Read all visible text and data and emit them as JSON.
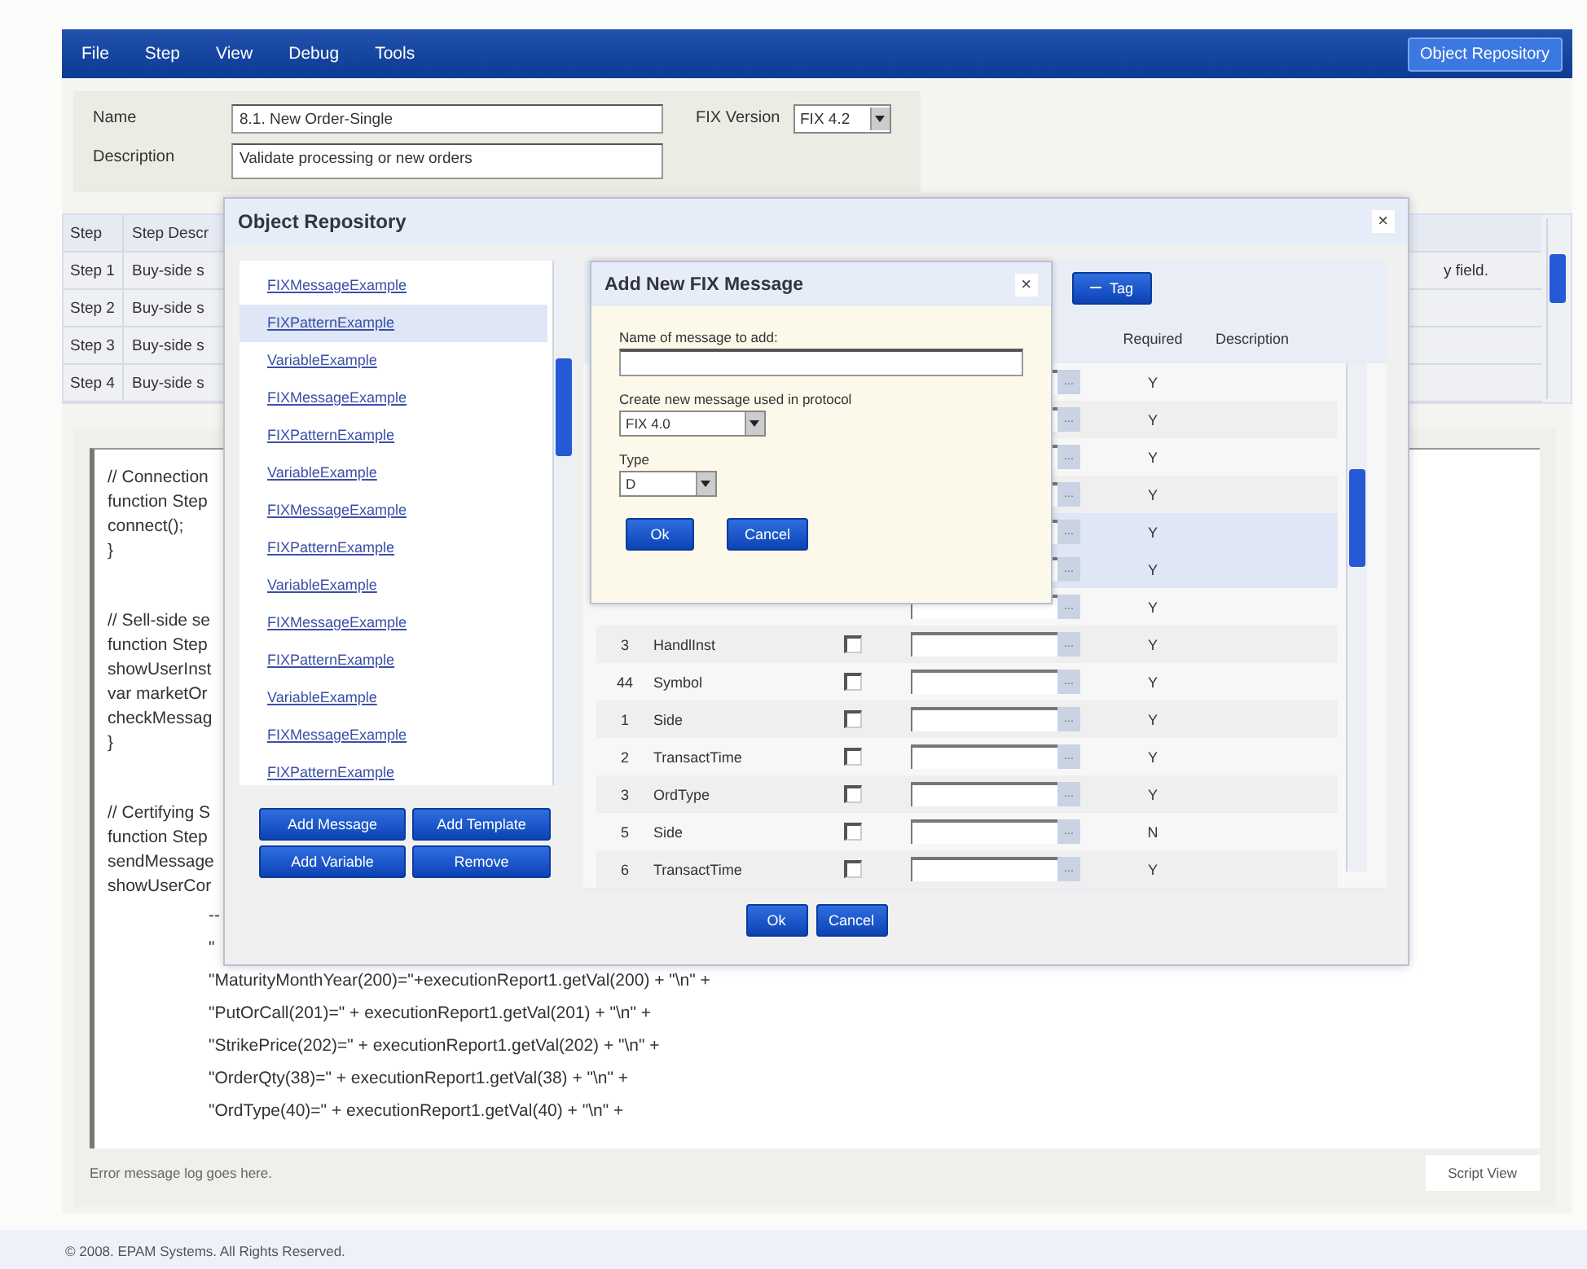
{
  "menu": {
    "items": [
      "File",
      "Step",
      "View",
      "Debug",
      "Tools"
    ],
    "repository_button": "Object Repository"
  },
  "form": {
    "name_label": "Name",
    "name_value": "8.1. New Order-Single",
    "description_label": "Description",
    "description_value": "Validate processing or new orders",
    "fix_version_label": "FIX Version",
    "fix_version_value": "FIX 4.2"
  },
  "steps_table": {
    "columns": [
      "Step",
      "Step Descr"
    ],
    "rows": [
      {
        "step": "Step 1",
        "description": "Buy-side s",
        "column_3": "y field."
      },
      {
        "step": "Step 2",
        "description": "Buy-side s"
      },
      {
        "step": "Step 3",
        "description": "Buy-side s"
      },
      {
        "step": "Step 4",
        "description": "Buy-side s"
      }
    ]
  },
  "script": {
    "blocks": [
      [
        {
          "kind": "statement",
          "text": "// Connection"
        },
        {
          "kind": "statement",
          "text": "function Step"
        },
        {
          "kind": "statement",
          "text": "connect();"
        },
        {
          "kind": "statement",
          "text": "}"
        }
      ],
      [
        {
          "kind": "statement",
          "text": "// Sell-side se"
        },
        {
          "kind": "statement",
          "text": "function Step"
        },
        {
          "kind": "statement",
          "text": "showUserInst"
        },
        {
          "kind": "statement",
          "text": "var marketOr"
        },
        {
          "kind": "statement",
          "text": "checkMessag"
        },
        {
          "kind": "statement",
          "text": "}"
        }
      ],
      [
        {
          "kind": "statement",
          "text": "// Certifying S"
        },
        {
          "kind": "statement",
          "text": "function Step"
        },
        {
          "kind": "statement",
          "text": "sendMessage"
        },
        {
          "kind": "statement",
          "text": "showUserCor"
        },
        {
          "kind": "continuation",
          "text": "--"
        },
        {
          "kind": "continuation",
          "text": "\""
        },
        {
          "kind": "continuation",
          "text": "\"MaturityMonthYear(200)=\"+executionReport1.getVal(200) + \"\\n\" +"
        },
        {
          "kind": "continuation",
          "text": "\"PutOrCall(201)=\" + executionReport1.getVal(201) + \"\\n\" +"
        },
        {
          "kind": "continuation",
          "text": "\"StrikePrice(202)=\" + executionReport1.getVal(202) + \"\\n\" +"
        },
        {
          "kind": "continuation",
          "text": "\"OrderQty(38)=\" + executionReport1.getVal(38) + \"\\n\" +"
        },
        {
          "kind": "continuation",
          "text": "\"OrdType(40)=\" + executionReport1.getVal(40) + \"\\n\" +"
        }
      ]
    ],
    "error_log": "Error message log goes here.",
    "script_view_button": "Script View"
  },
  "footer": "© 2008. EPAM Systems. All Rights Reserved.",
  "object_repository": {
    "title": "Object Repository",
    "close": "×",
    "items": [
      {
        "label": "FIXMessageExample",
        "selected": false
      },
      {
        "label": "FIXPatternExample",
        "selected": true
      },
      {
        "label": "VariableExample",
        "selected": false
      },
      {
        "label": "FIXMessageExample",
        "selected": false
      },
      {
        "label": "FIXPatternExample",
        "selected": false
      },
      {
        "label": "VariableExample",
        "selected": false
      },
      {
        "label": "FIXMessageExample",
        "selected": false
      },
      {
        "label": "FIXPatternExample",
        "selected": false
      },
      {
        "label": "VariableExample",
        "selected": false
      },
      {
        "label": "FIXMessageExample",
        "selected": false
      },
      {
        "label": "FIXPatternExample",
        "selected": false
      },
      {
        "label": "VariableExample",
        "selected": false
      },
      {
        "label": "FIXMessageExample",
        "selected": false
      },
      {
        "label": "FIXPatternExample",
        "selected": false
      }
    ],
    "list_buttons": [
      "Add Message",
      "Add Template",
      "Add Variable",
      "Remove"
    ],
    "tag_button": "Tag",
    "columns": {
      "required": "Required",
      "description": "Description"
    },
    "rows": [
      {
        "browse": "...",
        "required": "Y",
        "selected": false
      },
      {
        "browse": "...",
        "required": "Y",
        "selected": false
      },
      {
        "browse": "...",
        "required": "Y",
        "selected": false
      },
      {
        "browse": "...",
        "required": "Y",
        "selected": false
      },
      {
        "browse": "...",
        "required": "Y",
        "selected": true
      },
      {
        "browse": "...",
        "required": "Y",
        "selected": true
      },
      {
        "browse": "...",
        "required": "Y",
        "selected": false
      },
      {
        "tag": "3",
        "name": "HandlInst",
        "checked": false,
        "browse": "...",
        "required": "Y",
        "selected": false
      },
      {
        "tag": "44",
        "name": "Symbol",
        "checked": false,
        "browse": "...",
        "required": "Y",
        "selected": false
      },
      {
        "tag": "1",
        "name": "Side",
        "checked": false,
        "browse": "...",
        "required": "Y",
        "selected": false
      },
      {
        "tag": "2",
        "name": "TransactTime",
        "checked": false,
        "browse": "...",
        "required": "Y",
        "selected": false
      },
      {
        "tag": "3",
        "name": "OrdType",
        "checked": false,
        "browse": "...",
        "required": "Y",
        "selected": false
      },
      {
        "tag": "5",
        "name": "Side",
        "checked": false,
        "browse": "...",
        "required": "N",
        "selected": false
      },
      {
        "tag": "6",
        "name": "TransactTime",
        "checked": false,
        "browse": "...",
        "required": "Y",
        "selected": false
      }
    ],
    "buttons": [
      "Ok",
      "Cancel"
    ]
  },
  "add_message_dialog": {
    "title": "Add New FIX Message",
    "close": "×",
    "name_label": "Name of message to add:",
    "protocol_label": "Create new message used in protocol",
    "protocol_value": "FIX 4.0",
    "type_label": "Type",
    "type_value": "D",
    "buttons": [
      "Ok",
      "Cancel"
    ]
  }
}
